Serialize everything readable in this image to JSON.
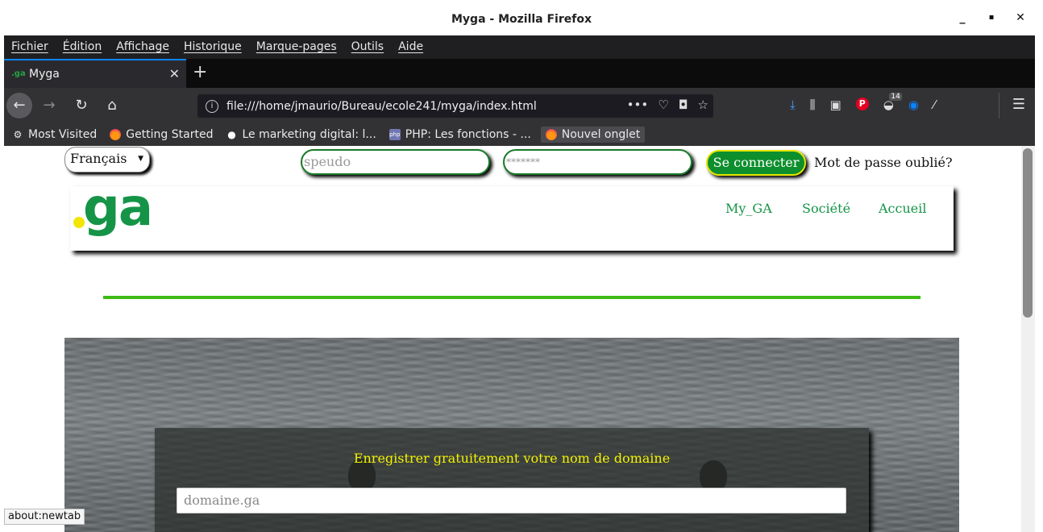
{
  "window": {
    "title": "Myga - Mozilla Firefox",
    "minimize": "_",
    "maximize": "▪",
    "close": "✕"
  },
  "menu": [
    "Fichier",
    "Édition",
    "Affichage",
    "Historique",
    "Marque-pages",
    "Outils",
    "Aide"
  ],
  "tab": {
    "title": "Myga",
    "favicon": ".ga",
    "close": "✕",
    "new_tab": "+"
  },
  "nav": {
    "back": "←",
    "forward": "→",
    "reload": "↻",
    "home": "⌂",
    "url": "file:///home/jmaurio/Bureau/ecole241/myga/index.html",
    "badge_count": "14",
    "page_actions": "•••"
  },
  "bookmarks": {
    "most_visited": "Most Visited",
    "getting_started": "Getting Started",
    "marketing": "Le marketing digital: l...",
    "php": "PHP: Les fonctions - ...",
    "new_tab": "Nouvel onglet"
  },
  "login": {
    "language": "Français",
    "pseudo_placeholder": "speudo",
    "password_placeholder": "*******",
    "connect_label": "Se connecter",
    "forgot_label": "Mot de passe oublié?"
  },
  "header": {
    "logo_text": "ga",
    "links": [
      "My_GA",
      "Société",
      "Accueil"
    ]
  },
  "hero": {
    "title": "Enregistrer gratuitement votre nom de domaine",
    "domain_placeholder": "domaine.ga"
  },
  "status": "about:newtab",
  "colors": {
    "brand_green": "#159447",
    "accent_yellow": "#f2e600",
    "line_green": "#3dbb15",
    "chrome_dark": "#1f1f21"
  }
}
